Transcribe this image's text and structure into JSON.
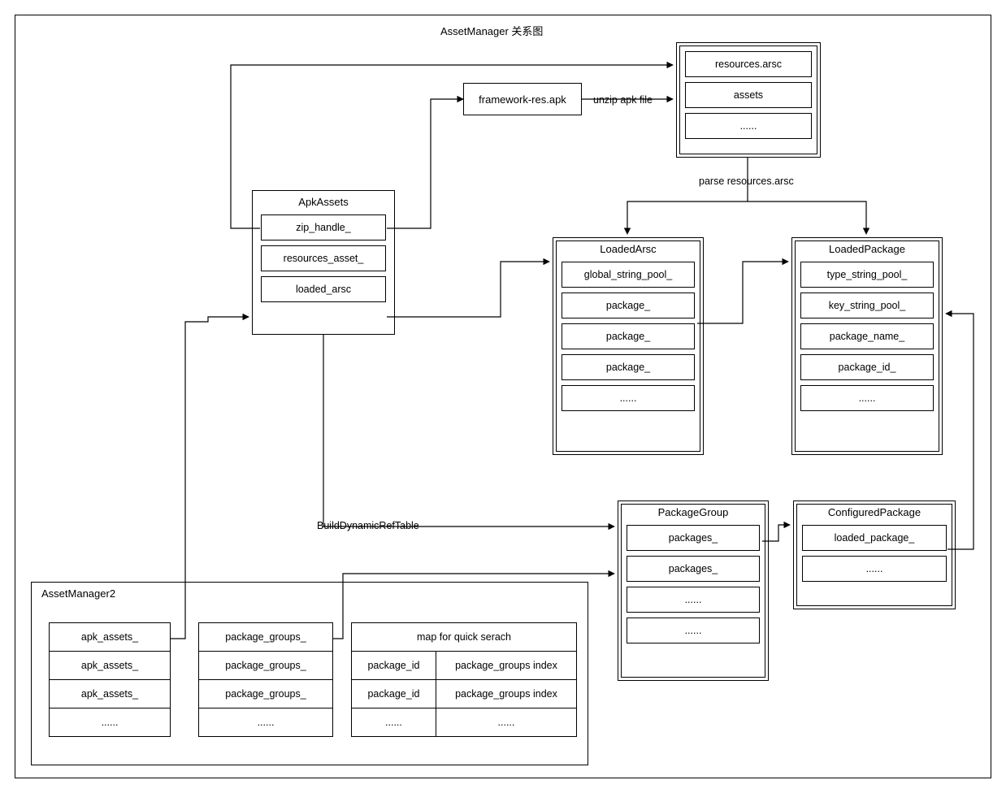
{
  "title": "AssetManager 关系图",
  "framework_res": "framework-res.apk",
  "unzip_label": "unzip apk file",
  "parse_label": "parse resources.arsc",
  "build_dyn_label": "BuildDynamicRefTable",
  "unzipped": {
    "rows": [
      "resources.arsc",
      "assets",
      "......"
    ]
  },
  "apk_assets": {
    "title": "ApkAssets",
    "rows": [
      "zip_handle_",
      "resources_asset_",
      "loaded_arsc"
    ]
  },
  "loaded_arsc": {
    "title": "LoadedArsc",
    "rows": [
      "global_string_pool_",
      "package_",
      "package_",
      "package_",
      "......"
    ]
  },
  "loaded_package": {
    "title": "LoadedPackage",
    "rows": [
      "type_string_pool_",
      "key_string_pool_",
      "package_name_",
      "package_id_",
      "......"
    ]
  },
  "package_group": {
    "title": "PackageGroup",
    "rows": [
      "packages_",
      "packages_",
      "......",
      "......"
    ]
  },
  "configured_package": {
    "title": "ConfiguredPackage",
    "rows": [
      "loaded_package_",
      "......"
    ]
  },
  "asset_manager2": {
    "title": "AssetManager2",
    "apk_assets_list": [
      "apk_assets_",
      "apk_assets_",
      "apk_assets_",
      "......"
    ],
    "package_groups_list": [
      "package_groups_",
      "package_groups_",
      "package_groups_",
      "......"
    ],
    "map_title": "map for quick serach",
    "map_rows": [
      [
        "package_id",
        "package_groups index"
      ],
      [
        "package_id",
        "package_groups index"
      ],
      [
        "......",
        "......"
      ]
    ]
  }
}
